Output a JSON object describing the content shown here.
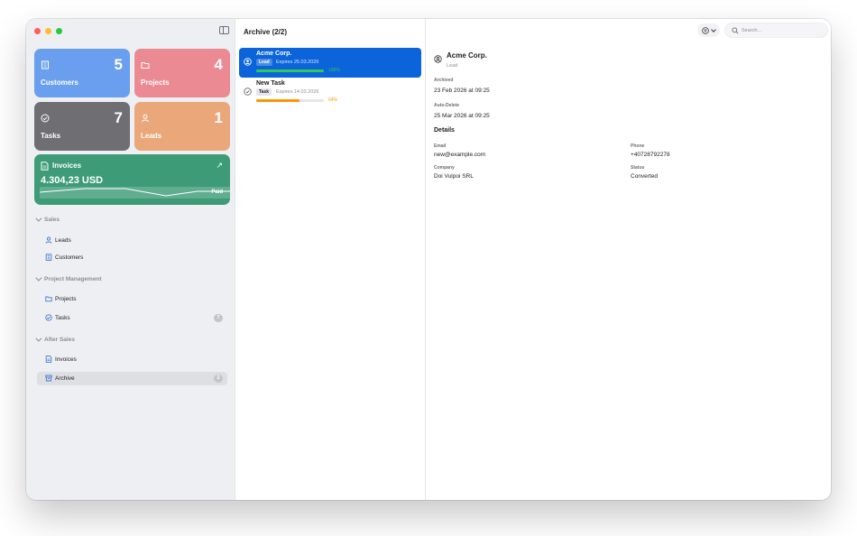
{
  "sidebar": {
    "tiles": {
      "customers": {
        "label": "Customers",
        "count": "5",
        "color": "#6a9fef"
      },
      "projects": {
        "label": "Projects",
        "count": "4",
        "color": "#eb8a92"
      },
      "tasks": {
        "label": "Tasks",
        "count": "7",
        "color": "#6e6e73"
      },
      "leads": {
        "label": "Leads",
        "count": "1",
        "color": "#eaa77a"
      }
    },
    "invoices_card": {
      "title": "Invoices",
      "amount": "4.304,23 USD",
      "status": "Paid",
      "color": "#3e9b78"
    },
    "sections": {
      "sales": {
        "title": "Sales",
        "leads": "Leads",
        "customers": "Customers"
      },
      "project_management": {
        "title": "Project Management",
        "projects": "Projects",
        "tasks": "Tasks",
        "tasks_badge": "7"
      },
      "after_sales": {
        "title": "After Sales",
        "invoices": "Invoices",
        "archive": "Archive",
        "archive_badge": "2"
      }
    }
  },
  "list": {
    "title": "Archive (2/2)",
    "items": [
      {
        "title": "Acme Corp.",
        "tag": "Lead",
        "expires": "Expires 25.03.2026",
        "progress": 100,
        "progress_label": "100%",
        "icon": "person-circle-icon"
      },
      {
        "title": "New Task",
        "tag": "Task",
        "expires": "Expires 14.03.2026",
        "progress": 64,
        "progress_label": "64%",
        "icon": "checkmark-circle-icon"
      }
    ]
  },
  "toolbar": {
    "search_placeholder": "Search..."
  },
  "detail": {
    "name": "Acme Corp.",
    "type": "Lead",
    "archived_label": "Archived",
    "archived_value": "23 Feb 2026 at 09:25",
    "auto_delete_label": "Auto-Delete",
    "auto_delete_value": "25 Mar 2026 at 09:25",
    "details_title": "Details",
    "email_label": "Email",
    "email_value": "new@example.com",
    "phone_label": "Phone",
    "phone_value": "+40728792278",
    "company_label": "Company",
    "company_value": "Doi Vulpoi SRL",
    "status_label": "Status",
    "status_value": "Converted"
  },
  "colors": {
    "accent": "#0b64d9",
    "success": "#34c759",
    "warning": "#ff9500"
  }
}
